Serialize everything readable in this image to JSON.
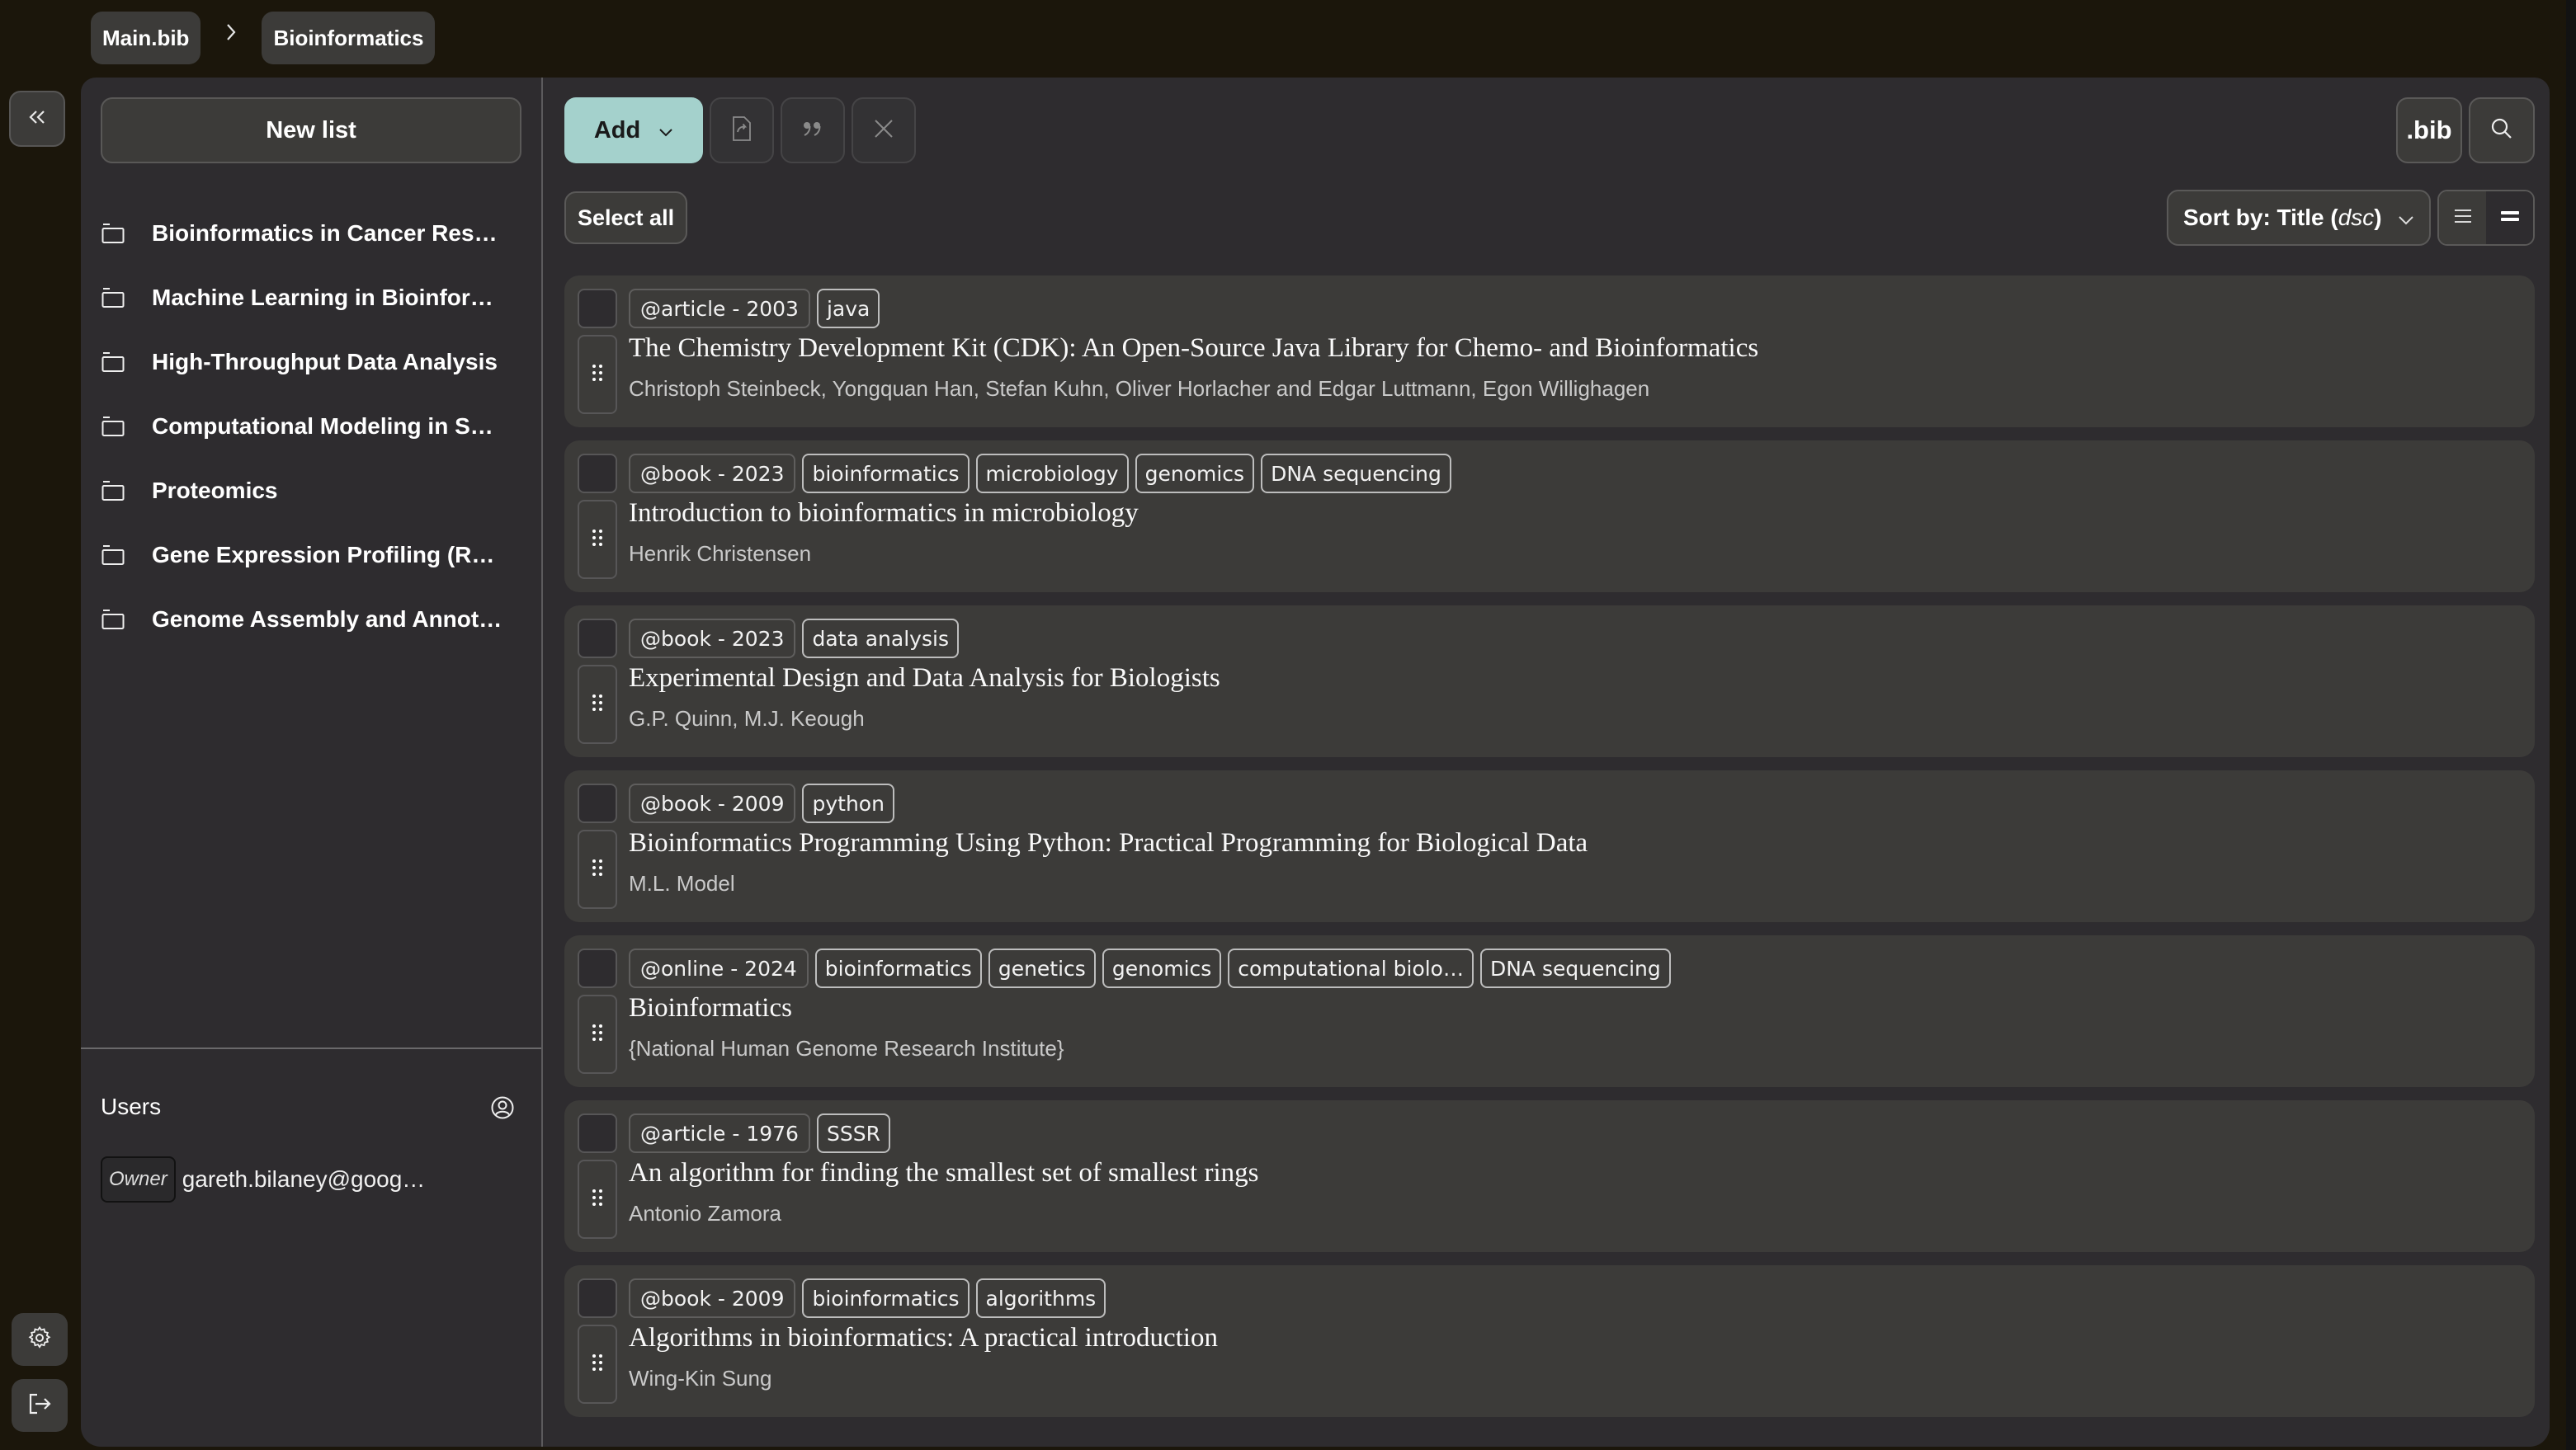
{
  "breadcrumb": {
    "items": [
      "Main.bib",
      "Bioinformatics"
    ]
  },
  "rail": {
    "collapse_icon": "chevrons-left-icon",
    "settings_icon": "gear-icon",
    "logout_icon": "logout-icon"
  },
  "sidebar": {
    "new_list_label": "New list",
    "lists": [
      {
        "label": "Bioinformatics in Cancer Rese…",
        "icon": "folder-icon"
      },
      {
        "label": "Machine Learning in Bioinfor…",
        "icon": "folder-icon"
      },
      {
        "label": "High-Throughput Data Analysis",
        "icon": "folder-icon"
      },
      {
        "label": "Computational Modeling in S…",
        "icon": "folder-icon"
      },
      {
        "label": "Proteomics",
        "icon": "folder-icon"
      },
      {
        "label": "Gene Expression Profiling (RN…",
        "icon": "folder-icon"
      },
      {
        "label": "Genome Assembly and Annot…",
        "icon": "folder-icon"
      }
    ],
    "users": {
      "title": "Users",
      "icon": "user-circle-icon",
      "members": [
        {
          "role": "Owner",
          "email": "gareth.bilaney@goog…"
        }
      ]
    }
  },
  "toolbar": {
    "add_label": "Add",
    "export_icon": "file-export-icon",
    "cite_icon": "quote-icon",
    "clear_icon": "close-icon",
    "select_all_label": "Select all",
    "bib_label": ".bib",
    "search_icon": "search-icon",
    "sort_prefix": "Sort by: Title (",
    "sort_dir": "dsc",
    "sort_suffix": ")",
    "view_modes": [
      "list-compact",
      "list-expanded"
    ],
    "active_view": "list-expanded"
  },
  "colors": {
    "accent": "#a4d1cc",
    "background": "#1b160b",
    "panel": "#2e2c2f",
    "card": "#3c3b39"
  },
  "entries": [
    {
      "type": "@article - 2003",
      "tags": [
        "java"
      ],
      "title": "The Chemistry Development Kit (CDK):  An Open-Source Java Library for Chemo- and Bioinformatics",
      "authors": "Christoph Steinbeck, Yongquan Han, Stefan Kuhn, Oliver Horlacher and Edgar Luttmann, Egon Willighagen"
    },
    {
      "type": "@book - 2023",
      "tags": [
        "bioinformatics",
        "microbiology",
        "genomics",
        "DNA sequencing"
      ],
      "title": "Introduction to bioinformatics in microbiology",
      "authors": "Henrik Christensen"
    },
    {
      "type": "@book - 2023",
      "tags": [
        "data analysis"
      ],
      "title": "Experimental Design and Data Analysis for Biologists",
      "authors": "G.P. Quinn, M.J. Keough"
    },
    {
      "type": "@book - 2009",
      "tags": [
        "python"
      ],
      "title": "Bioinformatics Programming Using Python: Practical Programming for Biological Data",
      "authors": "M.L. Model"
    },
    {
      "type": "@online - 2024",
      "tags": [
        "bioinformatics",
        "genetics",
        "genomics",
        "computational biolo…",
        "DNA sequencing"
      ],
      "title": "Bioinformatics",
      "authors": "{National Human Genome Research Institute}"
    },
    {
      "type": "@article - 1976",
      "tags": [
        "SSSR"
      ],
      "title": "An algorithm for finding the smallest set of smallest rings",
      "authors": "Antonio Zamora"
    },
    {
      "type": "@book - 2009",
      "tags": [
        "bioinformatics",
        "algorithms"
      ],
      "title": "Algorithms in bioinformatics: A practical introduction",
      "authors": "Wing-Kin Sung"
    }
  ]
}
